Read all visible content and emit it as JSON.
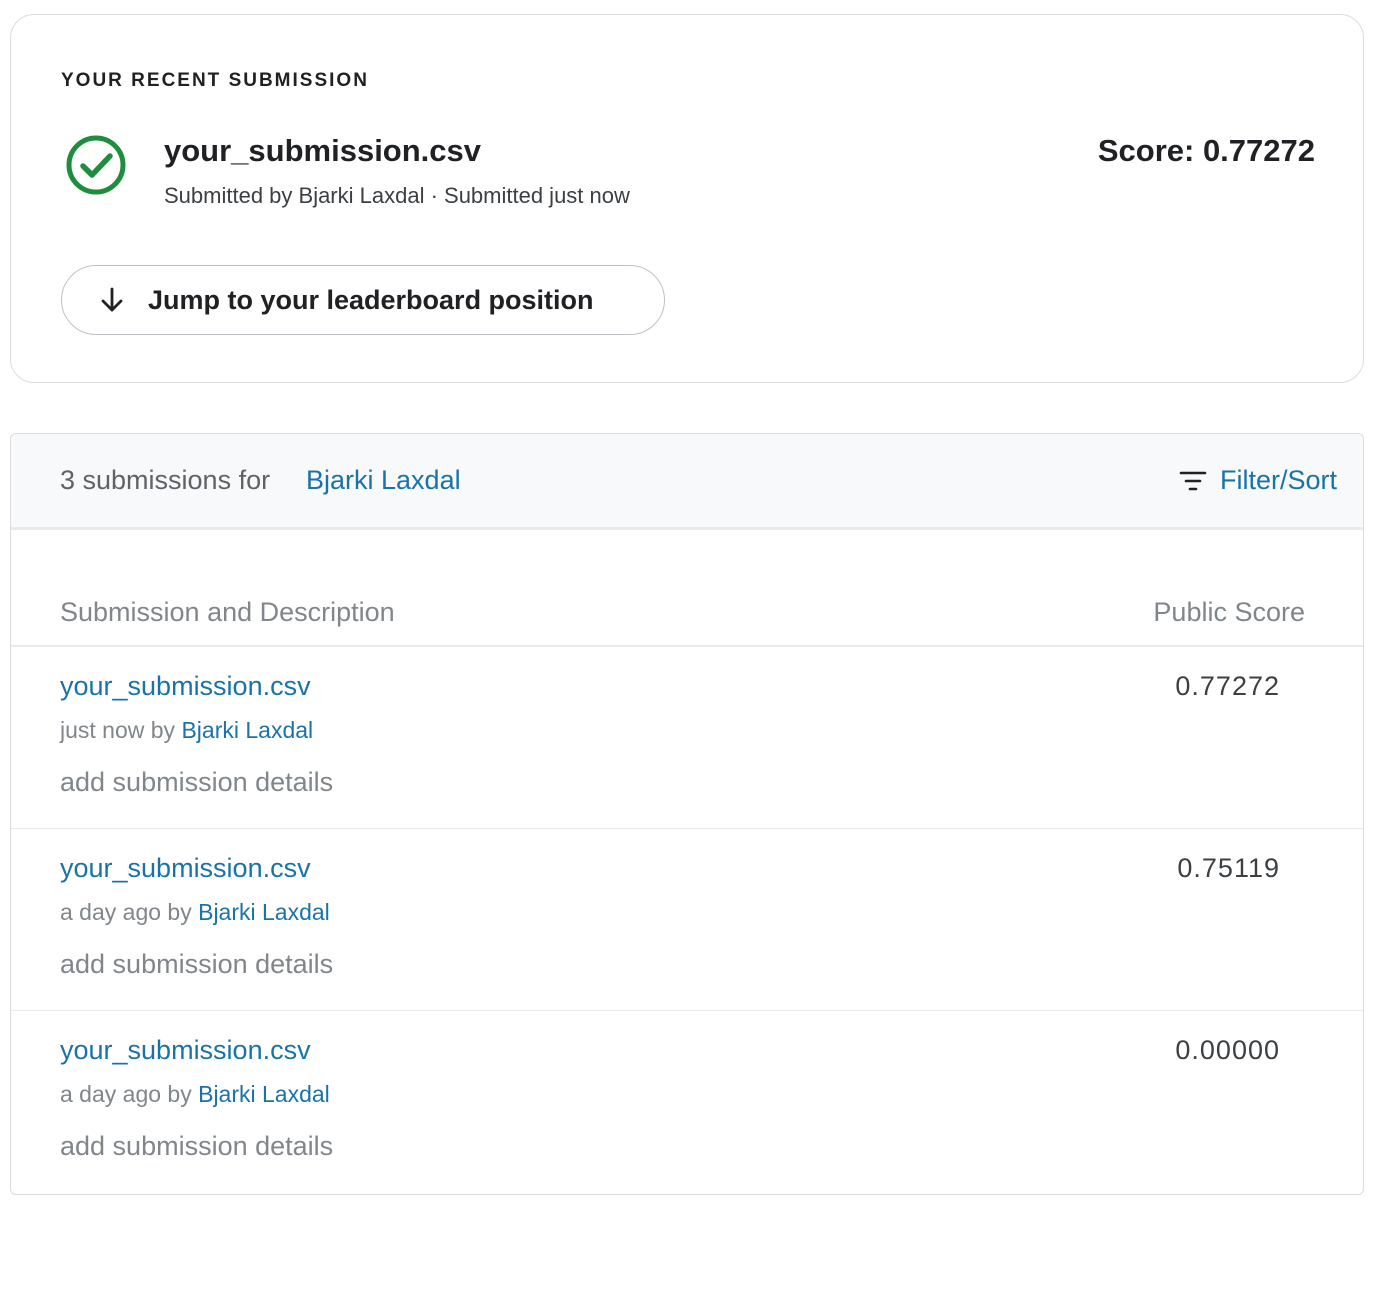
{
  "recent": {
    "heading": "YOUR RECENT SUBMISSION",
    "file_name": "your_submission.csv",
    "submitted_by": "Submitted by Bjarki Laxdal · Submitted just now",
    "score": "Score: 0.77272",
    "status_icon": "check-circle-icon",
    "jump_label": "Jump to your leaderboard position"
  },
  "submissions": {
    "count_label": "3 submissions for",
    "user": "Bjarki Laxdal",
    "filter_label": "Filter/Sort",
    "col_desc": "Submission and Description",
    "col_score": "Public Score",
    "rows": [
      {
        "name": "your_submission.csv",
        "when": "just now by",
        "by": "Bjarki Laxdal",
        "details": "add submission details",
        "score": "0.77272"
      },
      {
        "name": "your_submission.csv",
        "when": "a day ago by",
        "by": "Bjarki Laxdal",
        "details": "add submission details",
        "score": "0.75119"
      },
      {
        "name": "your_submission.csv",
        "when": "a day ago by",
        "by": "Bjarki Laxdal",
        "details": "add submission details",
        "score": "0.00000"
      }
    ]
  },
  "colors": {
    "success": "#1e8e3e",
    "link": "#1a73a8",
    "muted": "#80868b"
  }
}
